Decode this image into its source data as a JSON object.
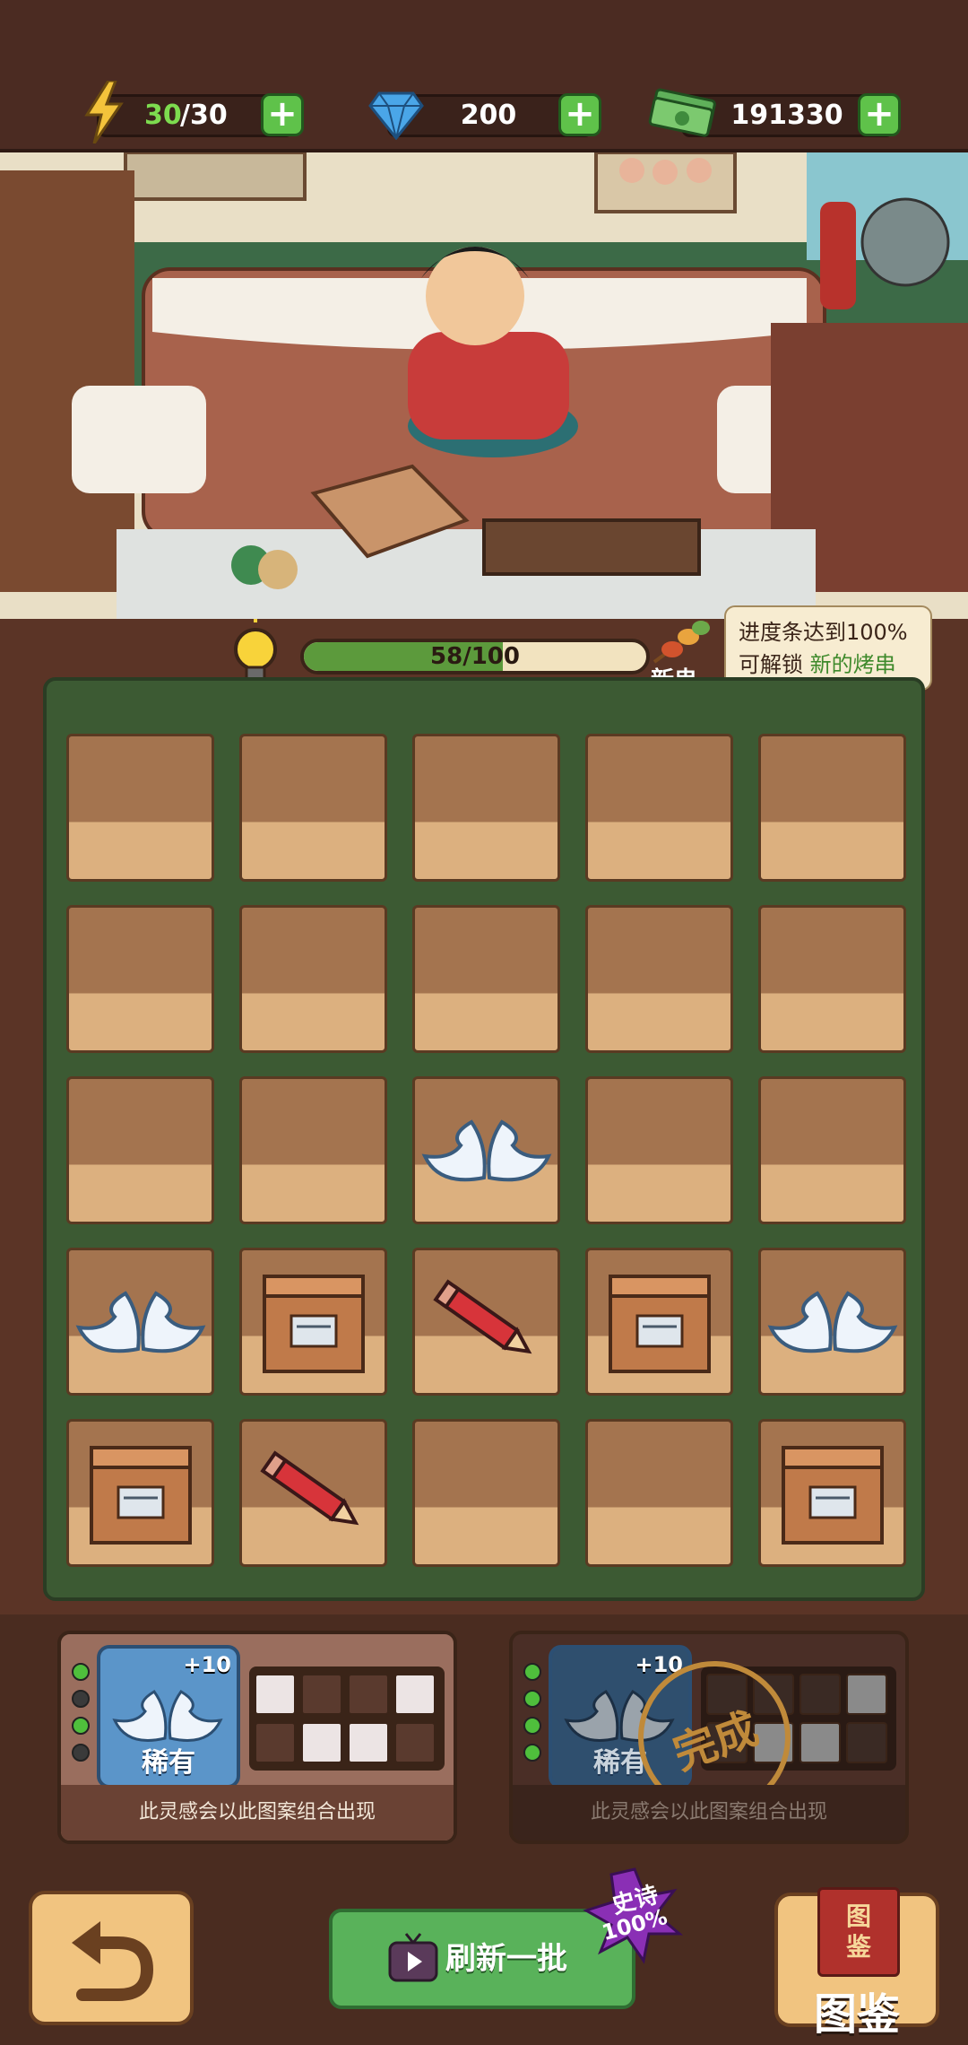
{
  "resources": {
    "energy": {
      "current": "30",
      "max": "/30"
    },
    "gems": "200",
    "money": "191330"
  },
  "progress": {
    "label": "58/100",
    "value": 58,
    "max": 100,
    "badge": "新串"
  },
  "tooltip": {
    "line1": "进度条达到100%",
    "line2_prefix": "可解锁 ",
    "line2_highlight": "新的烤串"
  },
  "board": {
    "rows": [
      [
        "empty",
        "empty",
        "empty",
        "empty",
        "empty"
      ],
      [
        "empty",
        "empty",
        "empty",
        "empty",
        "empty"
      ],
      [
        "empty",
        "empty",
        "wings",
        "empty",
        "empty"
      ],
      [
        "wings",
        "box",
        "pencil",
        "box",
        "wings"
      ],
      [
        "box",
        "pencil",
        "empty",
        "empty",
        "box"
      ]
    ]
  },
  "pattern_cards": [
    {
      "rarity": "稀有",
      "bonus": "+10",
      "caption": "此灵感会以此图案组合出现",
      "stamp": ""
    },
    {
      "rarity": "稀有",
      "bonus": "+10",
      "caption": "此灵感会以此图案组合出现",
      "stamp": "完成"
    }
  ],
  "controls": {
    "refresh": "刷新一批",
    "atlas": "图鉴",
    "atlas_book": "图鉴",
    "epic_badge": "史诗",
    "epic_percent": "100%"
  },
  "colors": {
    "accent_green": "#5fc24a",
    "board_green": "#3c5a33",
    "rare_blue": "#5b95c9"
  }
}
